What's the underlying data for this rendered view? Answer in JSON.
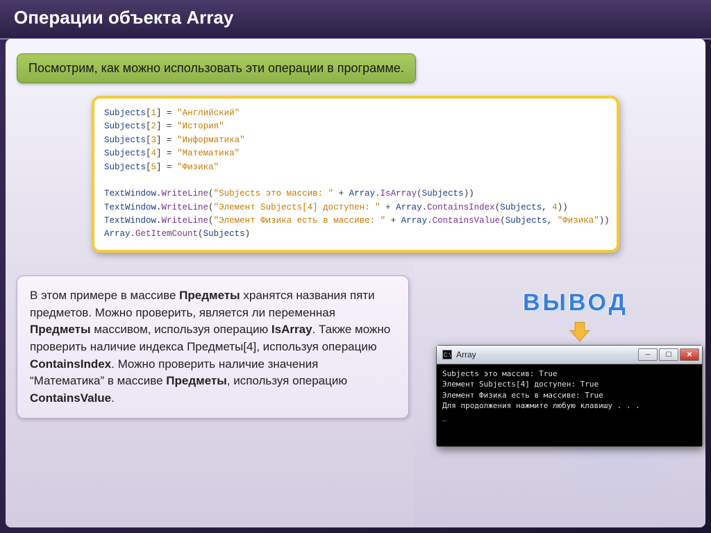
{
  "page_title": "Операции объекта Array",
  "intro_text": "Посмотрим, как можно использовать эти операции в программе.",
  "code": {
    "obj": "Subjects",
    "assignments": [
      {
        "idx": "1",
        "val": "\"Английский\""
      },
      {
        "idx": "2",
        "val": "\"История\""
      },
      {
        "idx": "3",
        "val": "\"Информатика\""
      },
      {
        "idx": "4",
        "val": "\"Математика\""
      },
      {
        "idx": "5",
        "val": "\"Физика\""
      }
    ],
    "calls": {
      "tw": "TextWindow",
      "wl": "WriteLine",
      "arr": "Array",
      "isArr": "IsArray",
      "ci": "ContainsIndex",
      "cv": "ContainsValue",
      "gic": "GetItemCount",
      "s1": "\"Subjects это массив: \"",
      "s2": "\"Элемент Subjects[4] доступен: \"",
      "s3": "\"Элемент Физика есть в массиве: \"",
      "idx4": "4",
      "phys": "\"Физика\""
    }
  },
  "description_html": "В этом примере в массиве <b>Предметы</b> хранятся названия пяти предметов. Можно проверить, является ли переменная <b>Предметы</b> массивом, используя операцию <b>IsArray</b>. Также можно проверить наличие индекса Предметы[4], используя операцию <b>ContainsIndex</b>. Можно проверить наличие значения “Математика” в массиве <b>Предметы</b>, используя операцию <b>ContainsValue</b>.",
  "output_label": "ВЫВОД",
  "console": {
    "title": "Array",
    "lines": [
      "Subjects это массив: True",
      "Элемент Subjects[4] доступен: True",
      "Элемент Физика есть в массиве: True",
      "Для продолжения нажмите любую клавишу . . ."
    ],
    "cursor": "_"
  }
}
